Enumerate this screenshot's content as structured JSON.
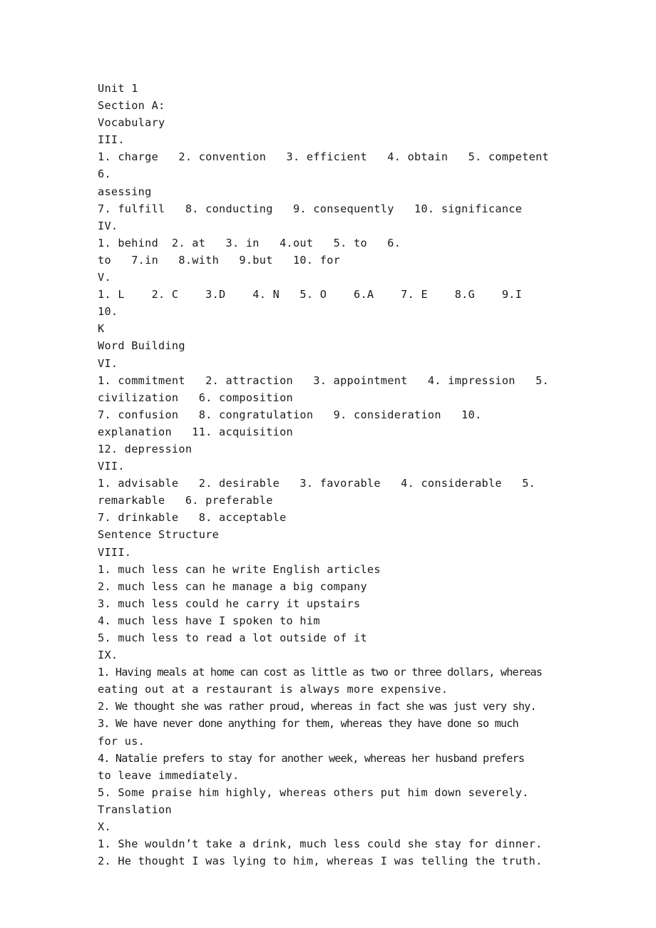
{
  "document": {
    "page_background": "#ffffff",
    "text_color": "#1a1a1a",
    "title": "Unit 1",
    "lines": [
      {
        "id": "l1",
        "text": "Unit 1",
        "style": "normal"
      },
      {
        "id": "l2",
        "text": "Section A:",
        "style": "normal"
      },
      {
        "id": "l3",
        "text": "Vocabulary",
        "style": "normal"
      },
      {
        "id": "l4",
        "text": "III.",
        "style": "normal"
      },
      {
        "id": "l5",
        "text": "1. charge   2. convention   3. efficient   4. obtain   5. competent   6.",
        "style": "normal"
      },
      {
        "id": "l6",
        "text": "asessing",
        "style": "normal"
      },
      {
        "id": "l7",
        "text": "7. fulfill   8. conducting   9. consequently   10. significance",
        "style": "normal"
      },
      {
        "id": "l8",
        "text": "IV.",
        "style": "normal"
      },
      {
        "id": "l9",
        "text": "1. behind  2. at   3. in   4.out   5. to   6.",
        "style": "normal"
      },
      {
        "id": "l10",
        "text": "to   7.in   8.with   9.but   10. for",
        "style": "normal"
      },
      {
        "id": "l11",
        "text": "V.",
        "style": "normal"
      },
      {
        "id": "l12",
        "text": "1. L    2. C    3.D    4. N   5. O    6.A    7. E    8.G    9.I    10.",
        "style": "normal"
      },
      {
        "id": "l13",
        "text": "K",
        "style": "normal"
      },
      {
        "id": "l14",
        "text": "Word Building",
        "style": "normal"
      },
      {
        "id": "l15",
        "text": "VI.",
        "style": "normal"
      },
      {
        "id": "l16",
        "text": "1. commitment   2. attraction   3. appointment   4. impression   5.",
        "style": "normal"
      },
      {
        "id": "l17",
        "text": "civilization   6. composition",
        "style": "normal"
      },
      {
        "id": "l18",
        "text": "7. confusion   8. congratulation   9. consideration   10.",
        "style": "normal"
      },
      {
        "id": "l19",
        "text": "explanation   11. acquisition",
        "style": "normal"
      },
      {
        "id": "l20",
        "text": "12. depression",
        "style": "normal"
      },
      {
        "id": "l21",
        "text": "VII.",
        "style": "normal"
      },
      {
        "id": "l22",
        "text": "1. advisable   2. desirable   3. favorable   4. considerable   5.",
        "style": "normal"
      },
      {
        "id": "l23",
        "text": "remarkable   6. preferable",
        "style": "normal"
      },
      {
        "id": "l24",
        "text": "7. drinkable   8. acceptable",
        "style": "normal"
      },
      {
        "id": "l25",
        "text": "Sentence Structure",
        "style": "normal"
      },
      {
        "id": "l26",
        "text": "VIII.",
        "style": "normal"
      },
      {
        "id": "l27",
        "text": "1. much less can he write English articles",
        "style": "normal"
      },
      {
        "id": "l28",
        "text": "2. much less can he manage a big company",
        "style": "normal"
      },
      {
        "id": "l29",
        "text": "3. much less could he carry it upstairs",
        "style": "normal"
      },
      {
        "id": "l30",
        "text": "4. much less have I spoken to him",
        "style": "normal"
      },
      {
        "id": "l31",
        "text": "5. much less to read a lot outside of it",
        "style": "normal"
      },
      {
        "id": "l32",
        "text": "IX.",
        "style": "normal"
      },
      {
        "id": "l33",
        "text": "1. Having meals at home can cost as little as two or three dollars, whereas",
        "style": "tighter"
      },
      {
        "id": "l34",
        "text": "eating out at a restaurant is always more expensive.",
        "style": "normal"
      },
      {
        "id": "l35",
        "text": "2. We thought she was rather proud, whereas in fact she was just very shy.",
        "style": "tighter"
      },
      {
        "id": "l36",
        "text": "3. We have never done anything for them, whereas they have done so much",
        "style": "tighter"
      },
      {
        "id": "l37",
        "text": "for us.",
        "style": "normal"
      },
      {
        "id": "l38",
        "text": "4. Natalie prefers to stay for another week, whereas her husband prefers",
        "style": "tighter"
      },
      {
        "id": "l39",
        "text": "to leave immediately.",
        "style": "normal"
      },
      {
        "id": "l40",
        "text": "5. Some praise him highly, whereas others put him down severely.",
        "style": "normal"
      },
      {
        "id": "l41",
        "text": "Translation",
        "style": "normal"
      },
      {
        "id": "l42",
        "text": "X.",
        "style": "normal"
      },
      {
        "id": "l43",
        "text": "1. She wouldn’t take a drink, much less could she stay for dinner.",
        "style": "normal"
      },
      {
        "id": "l44",
        "text": "2. He thought I was lying to him, whereas I was telling the truth.",
        "style": "normal"
      }
    ]
  },
  "sections": {
    "unit": "Unit 1",
    "section_a": "Section A:",
    "vocabulary_heading": "Vocabulary",
    "word_building_heading": "Word Building",
    "sentence_structure_heading": "Sentence Structure",
    "translation_heading": "Translation",
    "exercise_numbers": [
      "III.",
      "IV.",
      "V.",
      "VI.",
      "VII.",
      "VIII.",
      "IX.",
      "X."
    ]
  },
  "answers": {
    "III": [
      "charge",
      "convention",
      "efficient",
      "obtain",
      "competent",
      "asessing",
      "fulfill",
      "conducting",
      "consequently",
      "significance"
    ],
    "IV": [
      "behind",
      "at",
      "in",
      "out",
      "to",
      "to",
      "in",
      "with",
      "but",
      "for"
    ],
    "V": [
      "L",
      "C",
      "D",
      "N",
      "O",
      "A",
      "E",
      "G",
      "I",
      "K"
    ],
    "VI": [
      "commitment",
      "attraction",
      "appointment",
      "impression",
      "civilization",
      "composition",
      "confusion",
      "congratulation",
      "consideration",
      "explanation",
      "acquisition",
      "depression"
    ],
    "VII": [
      "advisable",
      "desirable",
      "favorable",
      "considerable",
      "remarkable",
      "preferable",
      "drinkable",
      "acceptable"
    ],
    "VIII": [
      "much less can he write English articles",
      "much less can he manage a big company",
      "much less could he carry it upstairs",
      "much less have I spoken to him",
      "much less to read a lot outside of it"
    ],
    "IX": [
      "Having meals at home can cost as little as two or three dollars, whereas eating out at a restaurant is always more expensive.",
      "We thought she was rather proud, whereas in fact she was just very shy.",
      "We have never done anything for them, whereas they have done so much for us.",
      "Natalie prefers to stay for another week, whereas her husband prefers to leave immediately.",
      "Some praise him highly, whereas others put him down severely."
    ],
    "X": [
      "She wouldn’t take a drink, much less could she stay for dinner.",
      "He thought I was lying to him, whereas I was telling the truth."
    ]
  }
}
